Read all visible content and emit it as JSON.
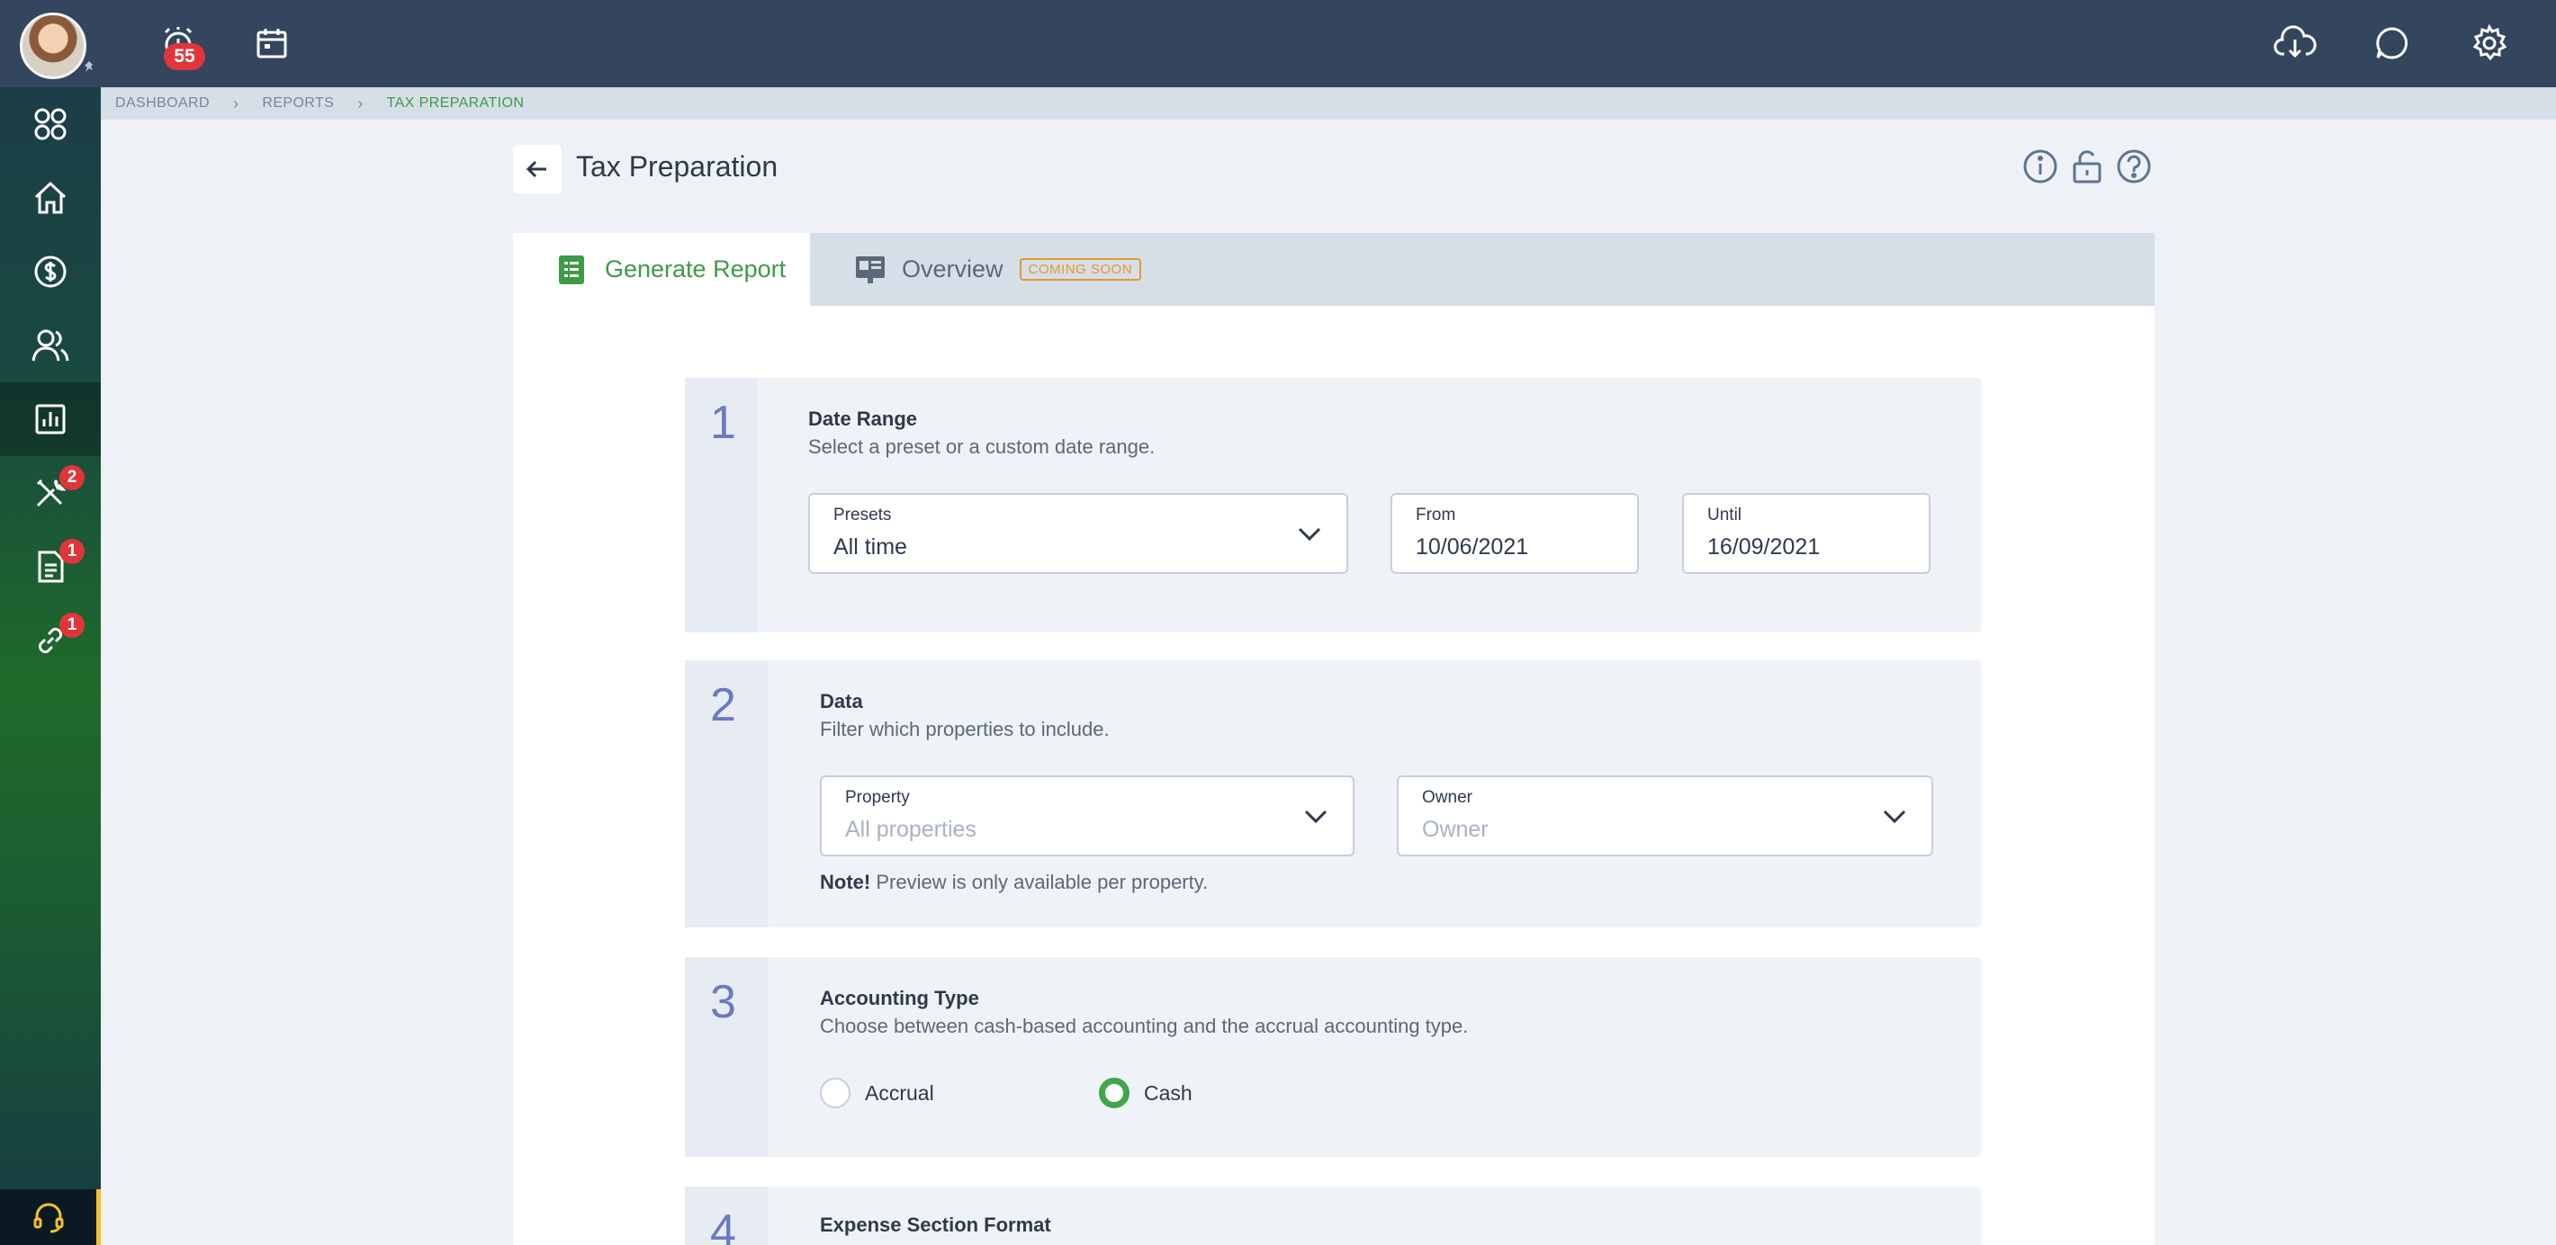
{
  "topbar": {
    "alarm_badge": "55"
  },
  "rail": {
    "items": [
      {
        "icon": "apps-grid-icon"
      },
      {
        "icon": "home-icon"
      },
      {
        "icon": "dollar-icon"
      },
      {
        "icon": "people-icon"
      },
      {
        "icon": "reports-chart-icon",
        "active": true
      },
      {
        "icon": "tools-icon",
        "badge": "2"
      },
      {
        "icon": "document-icon",
        "badge": "1"
      },
      {
        "icon": "link-icon",
        "badge": "1"
      }
    ]
  },
  "breadcrumb": {
    "items": [
      "DASHBOARD",
      "REPORTS",
      "TAX PREPARATION"
    ]
  },
  "header": {
    "title": "Tax Preparation"
  },
  "tabs": {
    "generate": "Generate Report",
    "overview": "Overview",
    "coming_soon": "COMING SOON"
  },
  "sections": {
    "date_range": {
      "number": "1",
      "title": "Date Range",
      "subtitle": "Select a preset or a custom date range.",
      "presets_label": "Presets",
      "presets_value": "All time",
      "from_label": "From",
      "from_value": "10/06/2021",
      "until_label": "Until",
      "until_value": "16/09/2021"
    },
    "data": {
      "number": "2",
      "title": "Data",
      "subtitle": "Filter which properties to include.",
      "property_label": "Property",
      "property_placeholder": "All properties",
      "owner_label": "Owner",
      "owner_placeholder": "Owner",
      "note_bold": "Note!",
      "note_text": "Preview is only available per property."
    },
    "accounting": {
      "number": "3",
      "title": "Accounting Type",
      "subtitle": "Choose between cash-based accounting and the accrual accounting type.",
      "options": [
        {
          "label": "Accrual",
          "selected": false
        },
        {
          "label": "Cash",
          "selected": true
        }
      ]
    },
    "expense": {
      "number": "4",
      "title": "Expense Section Format"
    }
  },
  "colors": {
    "topbar": "#34455e",
    "accent_green": "#3f9a47",
    "step_number": "#6b79c2",
    "badge_red": "#e0353b",
    "coming_soon": "#e39a2b"
  }
}
